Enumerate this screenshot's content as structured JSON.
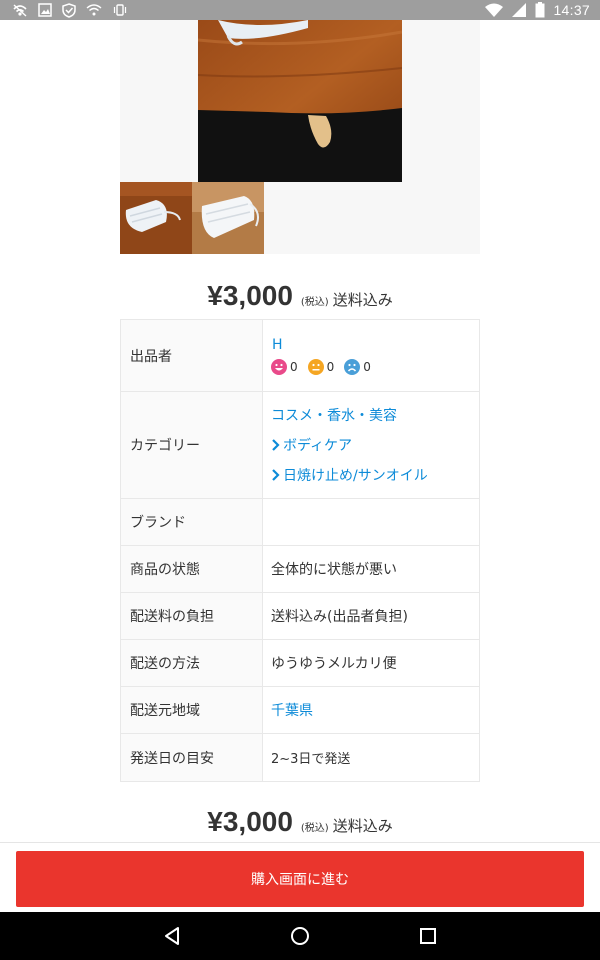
{
  "status_bar": {
    "time": "14:37",
    "icons": [
      "wifi-calling-icon",
      "image-icon",
      "shield-icon",
      "wifi-question-icon",
      "vibrate-icon",
      "wifi-icon",
      "signal-icon",
      "battery-icon"
    ]
  },
  "gallery": {
    "main_image": "mask-on-table-photo",
    "thumbnails": [
      "mask-thumbnail-1",
      "mask-thumbnail-2"
    ]
  },
  "price_top": {
    "amount": "¥3,000",
    "tax_label": "(税込)",
    "shipping_label": "送料込み"
  },
  "details": {
    "seller": {
      "label": "出品者",
      "name": "H",
      "good": "0",
      "normal": "0",
      "bad": "0"
    },
    "category": {
      "label": "カテゴリー",
      "level1": "コスメ・香水・美容",
      "level2": "ボディケア",
      "level3": "日焼け止め/サンオイル"
    },
    "brand": {
      "label": "ブランド",
      "value": ""
    },
    "condition": {
      "label": "商品の状態",
      "value": "全体的に状態が悪い"
    },
    "shipping_fee": {
      "label": "配送料の負担",
      "value": "送料込み(出品者負担)"
    },
    "shipping_method": {
      "label": "配送の方法",
      "value": "ゆうゆうメルカリ便"
    },
    "ship_from": {
      "label": "配送元地域",
      "value": "千葉県"
    },
    "ship_days": {
      "label": "発送日の目安",
      "value": "2~3日で発送"
    }
  },
  "price_bottom": {
    "amount": "¥3,000",
    "tax_label": "(税込)",
    "shipping_label": "送料込み"
  },
  "action": {
    "buy_label": "購入画面に進む"
  },
  "colors": {
    "accent_red": "#ea352d",
    "link_blue": "#0d8bd8",
    "good_pink": "#e94a8a",
    "normal_orange": "#f5a623",
    "bad_blue": "#4a9fd8"
  }
}
